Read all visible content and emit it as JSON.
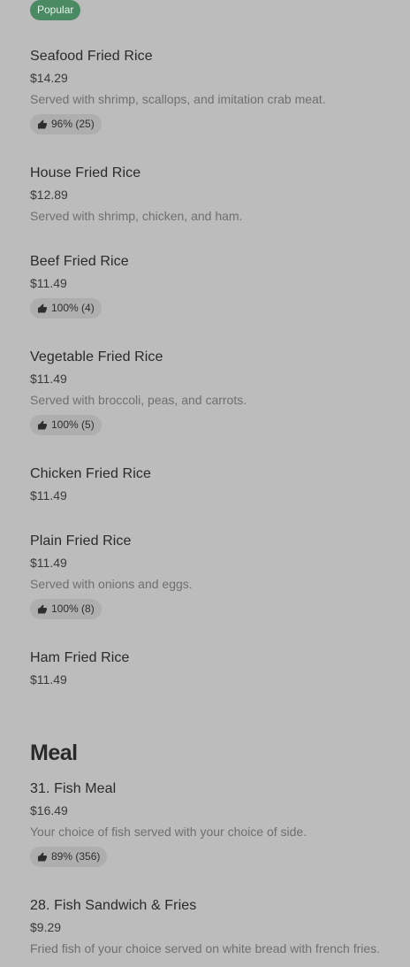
{
  "popular_badge": "Popular",
  "items": [
    {
      "name": "Seafood Fried Rice",
      "price": "$14.29",
      "description": "Served with shrimp, scallops, and imitation crab meat.",
      "rating": "96% (25)"
    },
    {
      "name": "House Fried Rice",
      "price": "$12.89",
      "description": "Served with shrimp, chicken, and ham."
    },
    {
      "name": "Beef Fried Rice",
      "price": "$11.49",
      "rating": "100% (4)"
    },
    {
      "name": "Vegetable Fried Rice",
      "price": "$11.49",
      "description": "Served with broccoli, peas, and carrots.",
      "rating": "100% (5)"
    },
    {
      "name": "Chicken Fried Rice",
      "price": "$11.49"
    },
    {
      "name": "Plain Fried Rice",
      "price": "$11.49",
      "description": "Served with onions and eggs.",
      "rating": "100% (8)"
    },
    {
      "name": "Ham Fried Rice",
      "price": "$11.49"
    }
  ],
  "meal_section": {
    "title": "Meal",
    "items": [
      {
        "name": "31. Fish Meal",
        "price": "$16.49",
        "description": "Your choice of fish served with your choice of side.",
        "rating": "89% (356)"
      },
      {
        "name": "28. Fish Sandwich & Fries",
        "price": "$9.29",
        "description": "Fried fish of your choice served on white bread with french fries."
      }
    ]
  },
  "icons": {
    "rating": "thumbs-up-icon"
  }
}
